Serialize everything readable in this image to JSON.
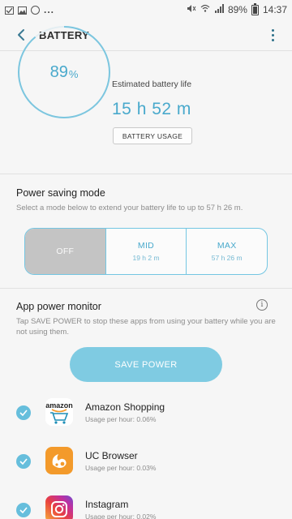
{
  "status_bar": {
    "left_icons": [
      "check-icon",
      "image-icon",
      "cat-icon"
    ],
    "ellipsis": "...",
    "battery_percent": "89%",
    "time": "14:37"
  },
  "app_bar": {
    "title": "BATTERY"
  },
  "battery": {
    "percent_value": "89",
    "percent_sign": "%",
    "percent_fraction": 0.89,
    "estimated_label": "Estimated battery life",
    "estimated_value": "15 h 52 m",
    "usage_button": "BATTERY USAGE",
    "accent_color": "#49a9cc"
  },
  "power_saving": {
    "title": "Power saving mode",
    "description": "Select a mode below to extend your battery life to up to 57 h 26 m.",
    "modes": [
      {
        "name": "OFF",
        "time": "",
        "selected": true
      },
      {
        "name": "MID",
        "time": "19 h 2 m",
        "selected": false
      },
      {
        "name": "MAX",
        "time": "57 h 26 m",
        "selected": false
      }
    ]
  },
  "app_monitor": {
    "title": "App power monitor",
    "description": "Tap SAVE POWER to stop these apps from using your battery while you are not using them.",
    "save_button": "SAVE POWER",
    "apps": [
      {
        "name": "Amazon Shopping",
        "usage": "Usage per hour: 0.06%",
        "icon": "amazon-icon",
        "icon_text": "amazon"
      },
      {
        "name": "UC Browser",
        "usage": "Usage per hour: 0.03%",
        "icon": "uc-browser-icon"
      },
      {
        "name": "Instagram",
        "usage": "Usage per hour: 0.02%",
        "icon": "instagram-icon"
      }
    ]
  }
}
